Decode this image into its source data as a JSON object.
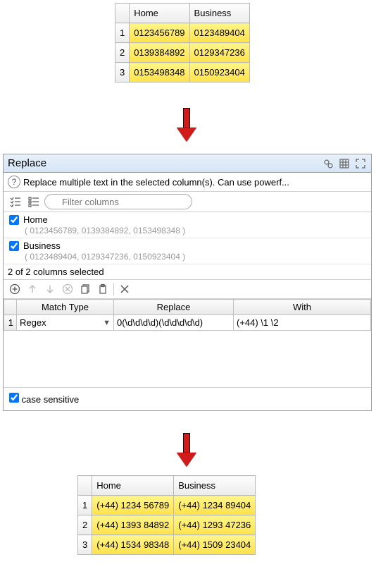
{
  "top_table": {
    "headers": [
      "Home",
      "Business"
    ],
    "rows": [
      [
        "0123456789",
        "0123489404"
      ],
      [
        "0139384892",
        "0129347236"
      ],
      [
        "0153498348",
        "0150923404"
      ]
    ]
  },
  "panel": {
    "title": "Replace",
    "description": "Replace multiple text in the selected column(s). Can use powerf...",
    "filter_placeholder": "Filter columns",
    "columns": [
      {
        "name": "Home",
        "checked": true,
        "samples": "( 0123456789, 0139384892, 0153498348 )"
      },
      {
        "name": "Business",
        "checked": true,
        "samples": "( 0123489404, 0129347236, 0150923404 )"
      }
    ],
    "selected_count": "2 of 2 columns selected",
    "rules_headers": [
      "Match Type",
      "Replace",
      "With"
    ],
    "rules": [
      {
        "match_type": "Regex",
        "replace": "0(\\d\\d\\d\\d)(\\d\\d\\d\\d\\d)",
        "with": "(+44) \\1 \\2"
      }
    ],
    "case_sensitive_label": "case sensitive",
    "case_sensitive": true
  },
  "bottom_table": {
    "headers": [
      "Home",
      "Business"
    ],
    "rows": [
      [
        "(+44) 1234 56789",
        "(+44) 1234 89404"
      ],
      [
        "(+44) 1393 84892",
        "(+44) 1293 47236"
      ],
      [
        "(+44) 1534 98348",
        "(+44) 1509 23404"
      ]
    ]
  }
}
